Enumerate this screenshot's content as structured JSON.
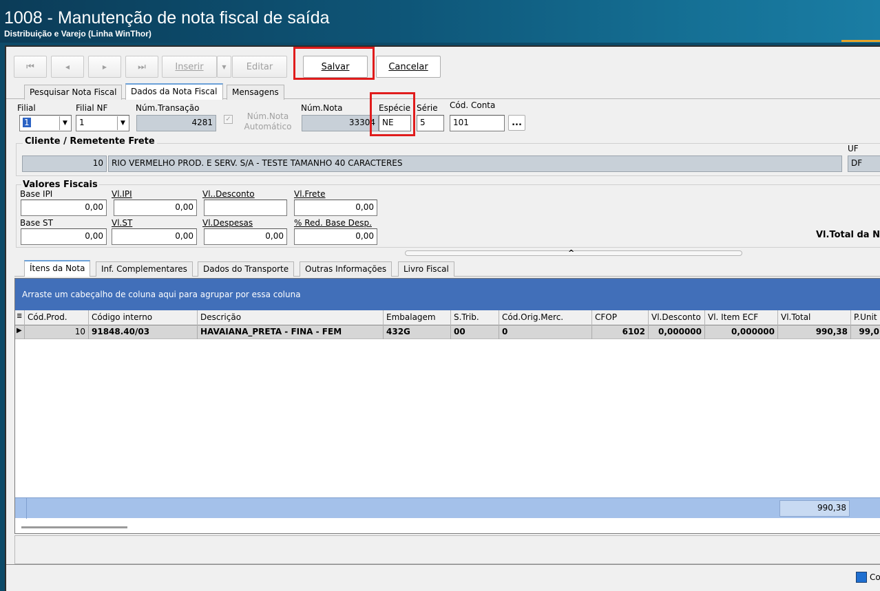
{
  "window": {
    "title": "1008 - Manutenção de nota fiscal de saída",
    "subtitle": "Distribuição e Varejo (Linha WinThor)"
  },
  "toolbar": {
    "first_label": "⏮",
    "prev_label": "◀",
    "next_label": "▶",
    "last_label": "⏭",
    "inserir_label": "Inserir",
    "editar_label": "Editar",
    "salvar_label": "Salvar",
    "cancelar_label": "Cancelar"
  },
  "main_tabs": [
    {
      "label": "Pesquisar Nota Fiscal"
    },
    {
      "label": "Dados da Nota Fiscal"
    },
    {
      "label": "Mensagens"
    }
  ],
  "header_fields": {
    "filial_label": "Filial",
    "filial_value": "1",
    "filial_nf_label": "Filial NF",
    "filial_nf_value": "1",
    "num_transacao_label": "Núm.Transação",
    "num_transacao_value": "4281",
    "num_nota_auto_label_1": "Núm.Nota",
    "num_nota_auto_label_2": "Automático",
    "num_nota_label": "Núm.Nota",
    "num_nota_value": "33304",
    "especie_label": "Espécie",
    "especie_value": "NE",
    "serie_label": "Série",
    "serie_value": "5",
    "cod_conta_label": "Cód. Conta",
    "cod_conta_value": "101",
    "cod_conta_button": "..."
  },
  "cliente": {
    "group_label": "Cliente / Remetente Frete",
    "code": "10",
    "name": "RIO VERMELHO PROD. E SERV. S/A - TESTE TAMANHO 40 CARACTERES",
    "uf_label": "UF",
    "uf_value": "DF"
  },
  "valores": {
    "group_label": "Valores Fiscais",
    "base_ipi_label": "Base IPI",
    "base_ipi_value": "0,00",
    "vl_ipi_label": "Vl.IPI",
    "vl_ipi_value": "0,00",
    "vl_desconto_label": "Vl..Desconto",
    "vl_desconto_value": "",
    "vl_frete_label": "Vl.Frete",
    "vl_frete_value": "0,00",
    "base_st_label": "Base ST",
    "base_st_value": "0,00",
    "vl_st_label": "Vl.ST",
    "vl_st_value": "0,00",
    "vl_despesas_label": "Vl.Despesas",
    "vl_despesas_value": "0,00",
    "red_base_label": "% Red. Base Desp.",
    "red_base_value": "0,00",
    "vl_total_label": "Vl.Total da N"
  },
  "sub_tabs": [
    {
      "label": "Ítens da Nota"
    },
    {
      "label": "Inf. Complementares"
    },
    {
      "label": "Dados do Transporte"
    },
    {
      "label": "Outras Informações"
    },
    {
      "label": "Livro Fiscal"
    }
  ],
  "grid": {
    "group_hint": "Arraste um cabeçalho de coluna aqui para agrupar por essa coluna",
    "columns": [
      "Cód.Prod.",
      "Código interno",
      "Descrição",
      "Embalagem",
      "S.Trib.",
      "Cód.Orig.Merc.",
      "CFOP",
      "Vl.Desconto",
      "Vl. Item ECF",
      "Vl.Total",
      "P.Unit"
    ],
    "rows": [
      [
        "10",
        "91848.40/03",
        "HAVAIANA_PRETA -  FINA - FEM",
        "432G",
        "00",
        "0",
        "6102",
        "0,000000",
        "0,000000",
        "990,38",
        "99,0"
      ]
    ],
    "footer_total": "990,38"
  },
  "bottom": {
    "legend_label": "Co"
  }
}
